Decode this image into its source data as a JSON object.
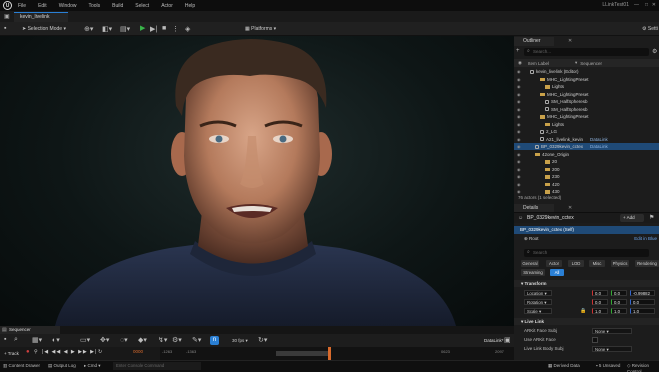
{
  "app": {
    "logo": "U",
    "menus": [
      "File",
      "Edit",
      "Window",
      "Tools",
      "Build",
      "Select",
      "Actor",
      "Help"
    ],
    "project": "LLinkTest01",
    "controls": [
      "—",
      "□",
      "✕"
    ]
  },
  "tab": {
    "level": "kevin_livelink"
  },
  "toolbar": {
    "selection_mode": "Selection Mode",
    "platforms": "Platforms",
    "settings": "Setti"
  },
  "outliner": {
    "tab": "Outliner",
    "search_placeholder": "Search...",
    "col_item": "Item Label",
    "col_sequencer": "Sequencer",
    "rows": [
      {
        "indent": 0,
        "kind": "world",
        "label": "kevin_livelink (Editor)",
        "type": ""
      },
      {
        "indent": 2,
        "kind": "folder",
        "label": "MHC_LightingPreset",
        "type": ""
      },
      {
        "indent": 3,
        "kind": "folder",
        "label": "Lights",
        "type": ""
      },
      {
        "indent": 2,
        "kind": "folder",
        "label": "MHC_LightingPreset",
        "type": ""
      },
      {
        "indent": 3,
        "kind": "actor",
        "label": "SM_HalfSpheresb",
        "type": ""
      },
      {
        "indent": 3,
        "kind": "actor",
        "label": "SM_HalfSpheresb",
        "type": ""
      },
      {
        "indent": 2,
        "kind": "folder",
        "label": "MHC_LightingPreset",
        "type": ""
      },
      {
        "indent": 3,
        "kind": "folder",
        "label": "Lights",
        "type": ""
      },
      {
        "indent": 2,
        "kind": "actor",
        "label": "2_LG",
        "type": ""
      },
      {
        "indent": 2,
        "kind": "actor",
        "label": "A21_livelink_kevin",
        "type": "DataLink"
      },
      {
        "indent": 1,
        "kind": "actor",
        "label": "BP_0329kevin_cctex",
        "type": "DataLink",
        "selected": true
      },
      {
        "indent": 1,
        "kind": "folder",
        "label": "42one_Origin",
        "type": ""
      },
      {
        "indent": 3,
        "kind": "folder",
        "label": "20",
        "type": ""
      },
      {
        "indent": 3,
        "kind": "folder",
        "label": "200",
        "type": ""
      },
      {
        "indent": 3,
        "kind": "folder",
        "label": "230",
        "type": ""
      },
      {
        "indent": 3,
        "kind": "folder",
        "label": "420",
        "type": ""
      },
      {
        "indent": 3,
        "kind": "folder",
        "label": "430",
        "type": ""
      }
    ],
    "status": "76 actors (1 selected)"
  },
  "details": {
    "tab": "Details",
    "actor_name": "BP_0329kevin_cctex",
    "add_label": "+ Add",
    "self_row": "BP_0329kevin_cctex (Self)",
    "root_row": "Root",
    "edit_in": "Edit in Blue",
    "search_placeholder": "Search",
    "categories": [
      "General",
      "Actor",
      "LOD",
      "Misc",
      "Physics",
      "Rendering",
      "Streaming",
      "All"
    ],
    "transform_head": "Transform",
    "location_label": "Location",
    "rotation_label": "Rotation",
    "scale_label": "Scale",
    "location": [
      "0.0",
      "0.0",
      "-0.99882"
    ],
    "rotation": [
      "0.0",
      "0.0",
      "0.0"
    ],
    "scale": [
      "1.0",
      "1.0",
      "1.0"
    ],
    "livelink_head": "Live Link",
    "arkit_face_subj": "ARKit Face Subj",
    "arkit_face_value": "None",
    "use_arkit_face": "Use ARKit Face",
    "body_subj": "Live Link Body Subj",
    "body_value": "None"
  },
  "sequencer": {
    "tab": "Sequencer",
    "track_btn": "+ Track",
    "fps": "30 fps",
    "frame": "0000",
    "datalink": "DataLink*",
    "ticks": [
      "-1263",
      "-1363",
      "0000",
      "0623",
      "2097"
    ]
  },
  "statusbar": {
    "content_drawer": "Content Drawer",
    "output_log": "Output Log",
    "cmd": "Cmd",
    "console_placeholder": "Enter Console Command",
    "derived_data": "Derived Data",
    "unsaved": "5 Unsaved",
    "revision": "Revision Control"
  },
  "colors": {
    "accent": "#2a7fd4",
    "selected_row": "#1f4a77",
    "folder": "#c9a14a",
    "play": "#39b54a",
    "playhead": "#d86a2c"
  }
}
